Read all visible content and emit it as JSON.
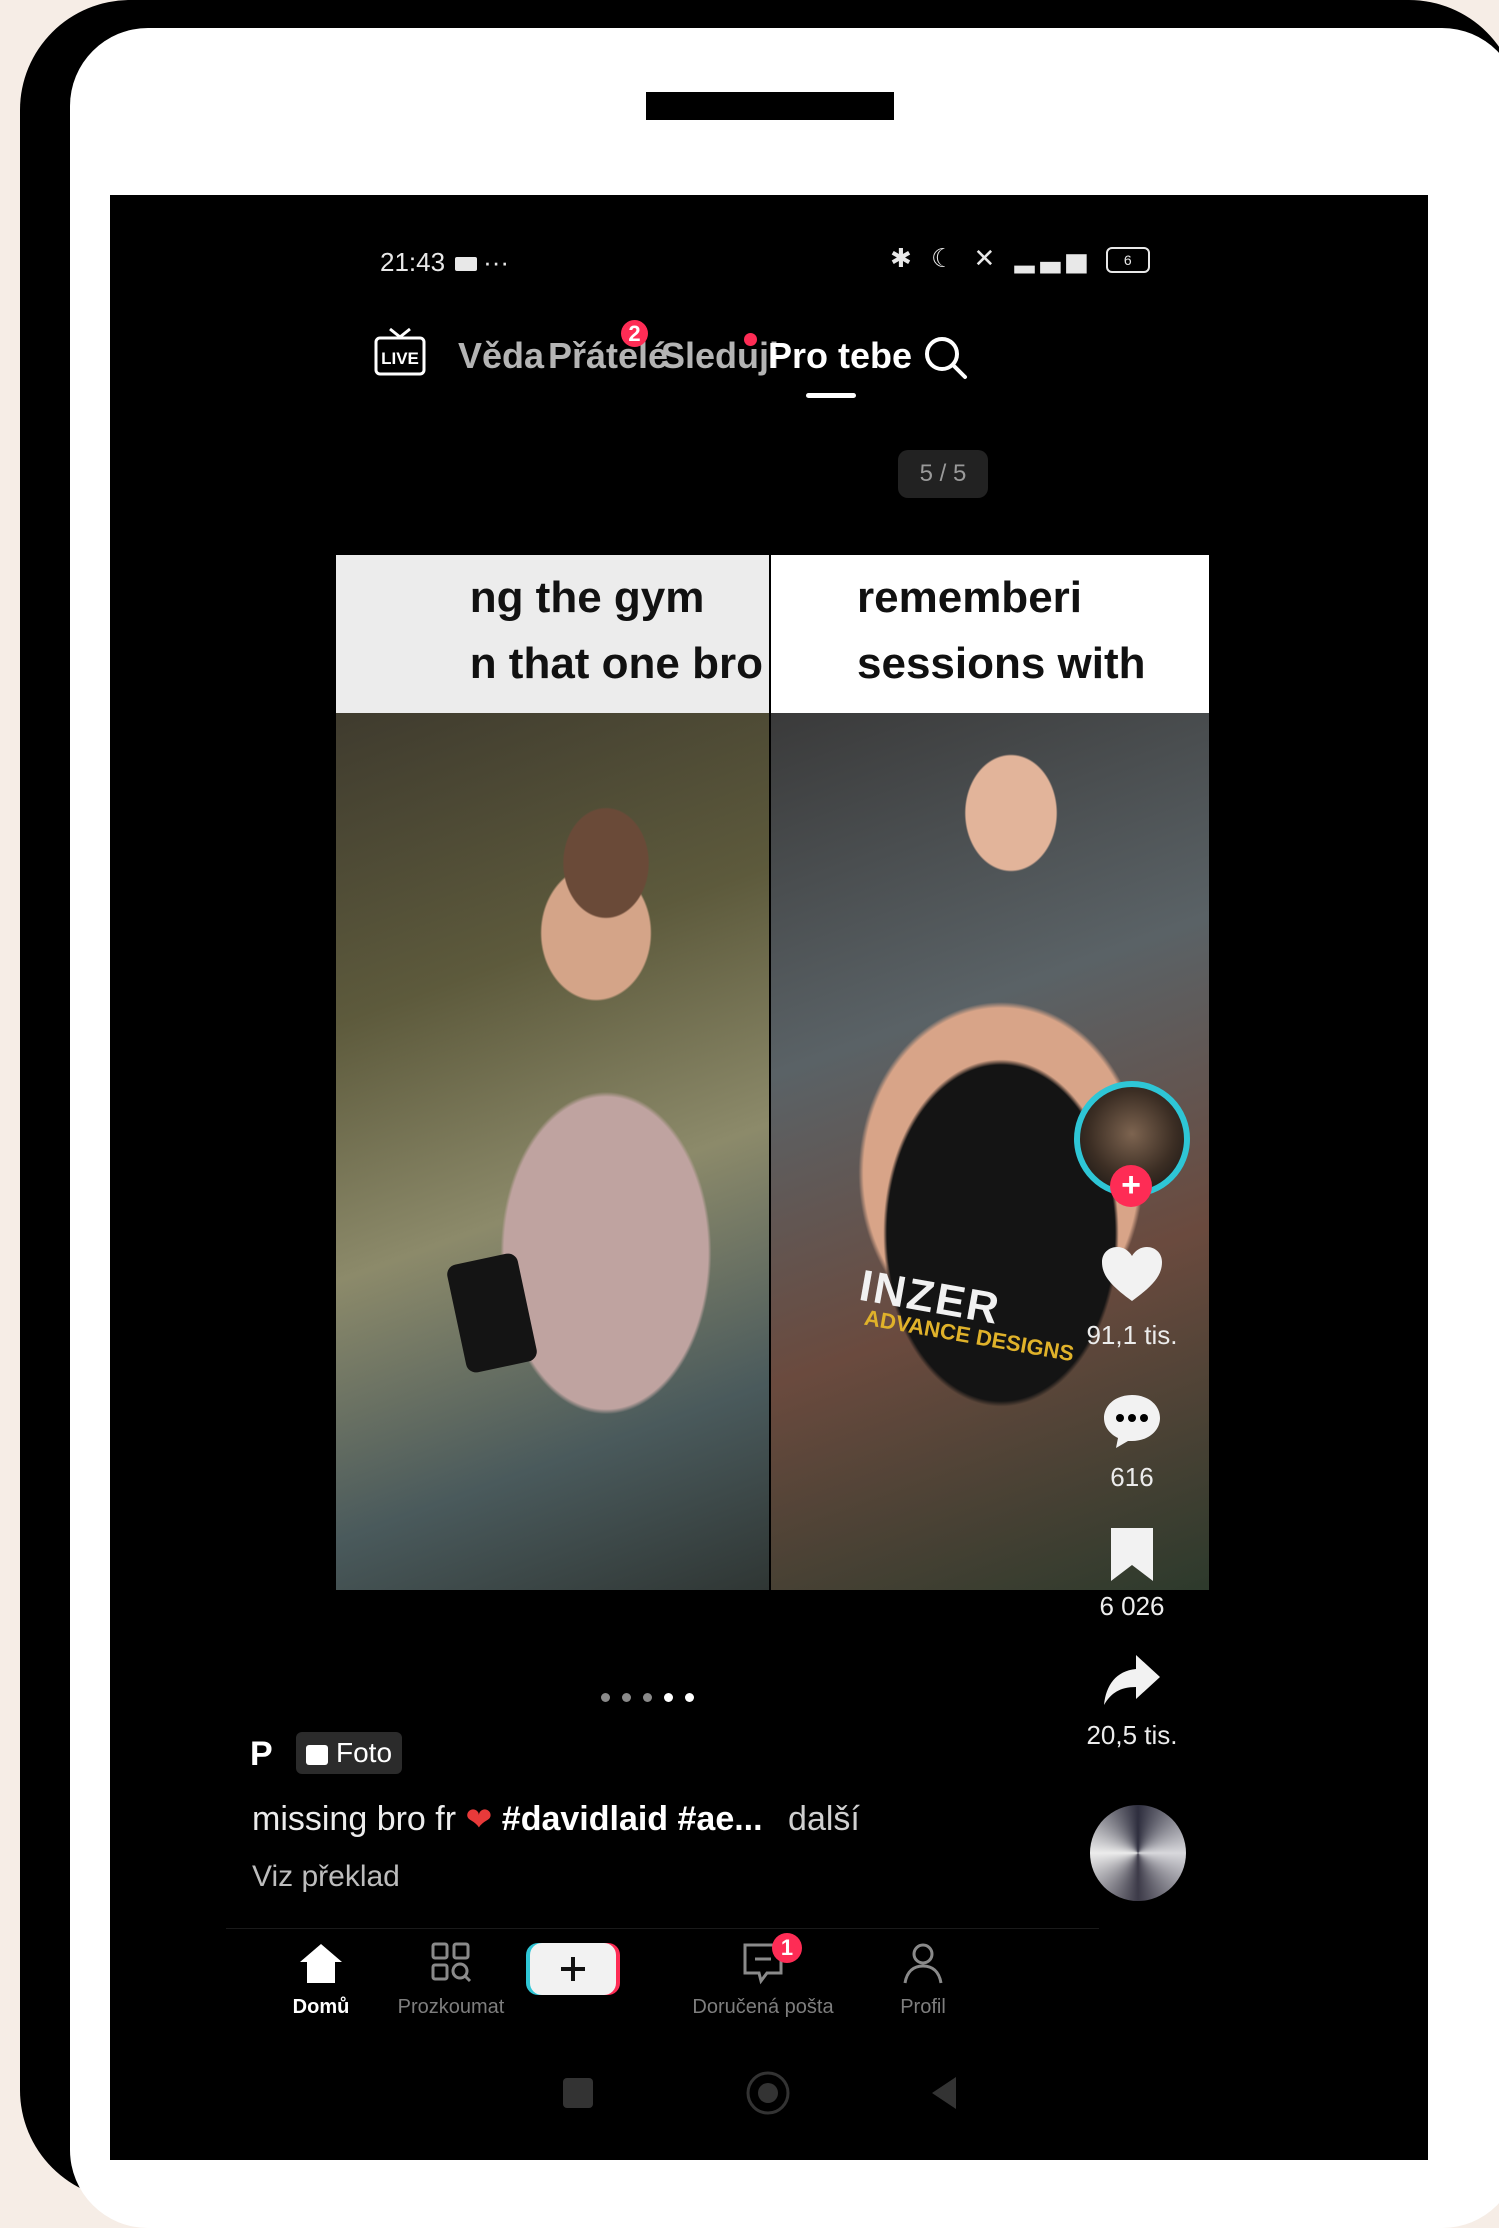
{
  "status_bar": {
    "time": "21:43",
    "extra": "···",
    "icons": "✱ ☾ ✕",
    "battery": "6"
  },
  "top_nav": {
    "live_label": "LIVE",
    "tabs": [
      {
        "label": "Věda"
      },
      {
        "label": "Přátelé",
        "badge": "2"
      },
      {
        "label": "Sleduji"
      },
      {
        "label": "Pro tebe"
      }
    ]
  },
  "page_counter": "5 / 5",
  "photo": {
    "left_caption": [
      "ng the gym",
      "n that one bro"
    ],
    "right_caption": [
      "rememberi",
      "sessions with"
    ],
    "shirt_text": "INZER",
    "shirt_sub": "ADVANCE DESIGNS"
  },
  "actions": {
    "likes": "91,1 tis.",
    "comments": "616",
    "saves": "6 026",
    "shares": "20,5 tis."
  },
  "post": {
    "author": "P",
    "type_tag": "Foto",
    "description_text": "missing bro fr",
    "description_tags": "#davidlaid #ae...",
    "more_label": "další",
    "translate_label": "Viz překlad"
  },
  "bottom_nav": {
    "items": [
      {
        "label": "Domů"
      },
      {
        "label": "Prozkoumat"
      },
      {
        "label": "Doručená pošta",
        "badge": "1"
      },
      {
        "label": "Profil"
      }
    ]
  },
  "colors": {
    "accent": "#fe2c55",
    "cyan": "#2ec6d6",
    "background": "#000000"
  }
}
